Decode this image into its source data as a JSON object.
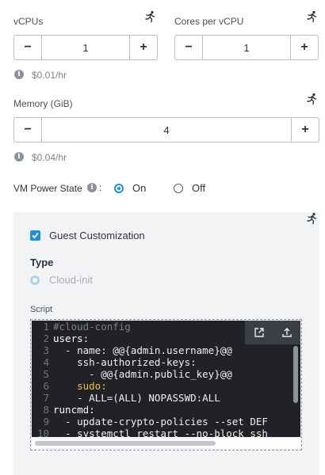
{
  "vcpus": {
    "label": "vCPUs",
    "value": "1",
    "minus": "−",
    "plus": "+",
    "price": "$0.01/hr"
  },
  "cores": {
    "label": "Cores per vCPU",
    "value": "1",
    "minus": "−",
    "plus": "+"
  },
  "memory": {
    "label": "Memory (GiB)",
    "value": "4",
    "minus": "−",
    "plus": "+",
    "price": "$0.04/hr"
  },
  "power": {
    "label": "VM Power State",
    "colon": ":",
    "on_label": "On",
    "off_label": "Off",
    "selected": "On"
  },
  "guest": {
    "checkbox_label": "Guest Customization",
    "checked": true,
    "type_label": "Type",
    "type_option": "Cloud-init",
    "script_label": "Script"
  },
  "script_lines": [
    {
      "n": "1",
      "text": "#cloud-config"
    },
    {
      "n": "2",
      "text": "users:"
    },
    {
      "n": "3",
      "text": "  - name: @@{admin.username}@@"
    },
    {
      "n": "4",
      "text": "    ssh-authorized-keys:"
    },
    {
      "n": "5",
      "text": "      - @@{admin.public_key}@@"
    },
    {
      "n": "6",
      "text": "    sudo:"
    },
    {
      "n": "7",
      "text": "    - ALL=(ALL) NOPASSWD:ALL"
    },
    {
      "n": "8",
      "text": "runcmd:"
    },
    {
      "n": "9",
      "text": "  - update-crypto-policies --set DEF"
    },
    {
      "n": "10",
      "text": "  - systemctl restart --no-block ssh"
    }
  ],
  "icons": {
    "runner": "running-person-icon",
    "info": "info-icon",
    "open": "open-external-icon",
    "upload": "upload-icon"
  },
  "colors": {
    "accent": "#1c8fe0",
    "editor_bg": "#202228",
    "panel_bg": "#f2f3f5"
  }
}
